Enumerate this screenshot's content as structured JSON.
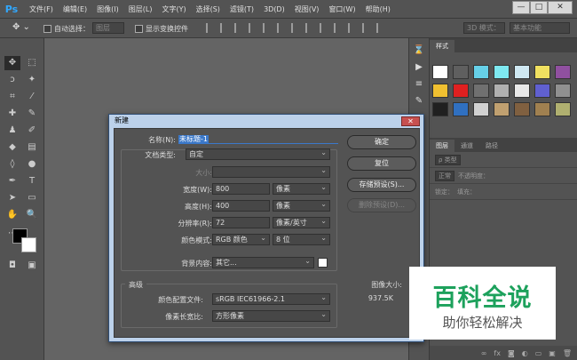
{
  "app": {
    "logo": "Ps"
  },
  "menu": [
    "文件(F)",
    "编辑(E)",
    "图像(I)",
    "图层(L)",
    "文字(Y)",
    "选择(S)",
    "滤镜(T)",
    "3D(D)",
    "视图(V)",
    "窗口(W)",
    "帮助(H)"
  ],
  "window_buttons": {
    "minimize": "—",
    "maximize": "□",
    "close": "✕"
  },
  "options": {
    "auto_select": "自动选择：",
    "auto_select_value": "图层",
    "show_transform": "显示变换控件",
    "mode3d": "3D 模式：",
    "workspace": "基本功能"
  },
  "panel": {
    "tabs1": [
      "样式"
    ],
    "tabs2": [
      "图层",
      "通道",
      "路径"
    ],
    "layer_type": "ρ 类型",
    "blend": "正常",
    "opacity": "不透明度：",
    "lock": "锁定：",
    "fill": "填充："
  },
  "swatches": [
    "#ffffff",
    "#5f5f5f",
    "#66d0e8",
    "#7ee8f0",
    "#cfe8f2",
    "#f0e060",
    "#9050a0",
    "#f0c030",
    "#e02020",
    "#707070",
    "#b0b0b0",
    "#e8e8e8",
    "#6060d0",
    "#909090",
    "#202020",
    "#3070c0",
    "#d0d0d0",
    "#c0a070",
    "#806040",
    "#a08050",
    "#b0b070"
  ],
  "dialog": {
    "title": "新建",
    "close": "✕",
    "name_label": "名称(N):",
    "name_value": "未标题-1",
    "preset_label": "文档类型:",
    "preset_value": "自定",
    "size_label": "大小:",
    "width_label": "宽度(W):",
    "width_value": "800",
    "width_unit": "像素",
    "height_label": "高度(H):",
    "height_value": "400",
    "height_unit": "像素",
    "res_label": "分辨率(R):",
    "res_value": "72",
    "res_unit": "像素/英寸",
    "mode_label": "颜色模式:",
    "mode_value": "RGB 颜色",
    "bits_value": "8 位",
    "bg_label": "背景内容:",
    "bg_value": "其它...",
    "advanced": "高级",
    "profile_label": "颜色配置文件:",
    "profile_value": "sRGB IEC61966-2.1",
    "aspect_label": "像素长宽比:",
    "aspect_value": "方形像素",
    "ok": "确定",
    "reset": "复位",
    "save_preset": "存储预设(S)...",
    "delete_preset": "删除预设(D)...",
    "image_size_label": "图像大小:",
    "image_size_value": "937.5K"
  },
  "watermark": {
    "main": "百科全说",
    "sub": "助你轻松解决"
  }
}
